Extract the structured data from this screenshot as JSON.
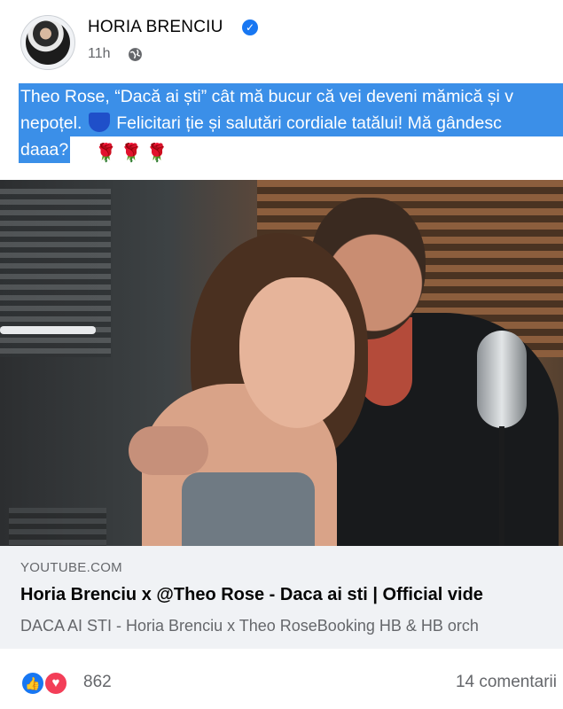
{
  "post": {
    "author": "HORIA BRENCIU",
    "time": "11h",
    "icons": {
      "verified": "verified-badge-icon",
      "audience": "globe-icon"
    },
    "text": {
      "line1": "Theo Rose, “Dacă ai ști” cât mă bucur că vei deveni mămică și v",
      "line2_a": "nepoțel.",
      "line2_b": " Felicitari ție și salutări cordiale tatălui! Mă gândesc",
      "line3": "daaa?",
      "roses": "🌹🌹🌹"
    }
  },
  "link_preview": {
    "domain": "YOUTUBE.COM",
    "title": "Horia Brenciu x @Theo Rose - Daca ai sti | Official vide",
    "description": "DACA AI STI - Horia Brenciu x Theo RoseBooking HB & HB orch"
  },
  "reactions": {
    "count": "862",
    "comments": "14 comentarii",
    "types": [
      "like-icon",
      "love-icon"
    ]
  },
  "colors": {
    "selection": "#3b8fe8",
    "verified": "#1877f2",
    "like": "#1877f2",
    "love": "#f33e58"
  }
}
